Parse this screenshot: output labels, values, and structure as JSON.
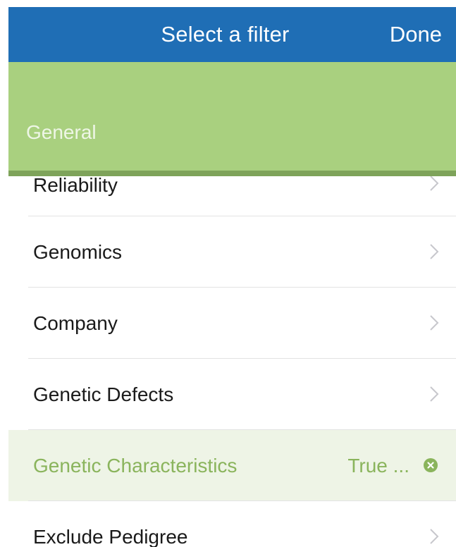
{
  "navbar": {
    "title": "Select a filter",
    "done_label": "Done",
    "color": "#1f6eb5"
  },
  "section": {
    "label": "General",
    "color": "#a9d07f"
  },
  "filters": [
    {
      "label": "Reliability",
      "value": "",
      "selected": false
    },
    {
      "label": "Genomics",
      "value": "",
      "selected": false
    },
    {
      "label": "Company",
      "value": "",
      "selected": false
    },
    {
      "label": "Genetic Defects",
      "value": "",
      "selected": false
    },
    {
      "label": "Genetic Characteristics",
      "value": "True ...",
      "selected": true
    },
    {
      "label": "Exclude Pedigree",
      "value": "",
      "selected": false
    }
  ],
  "icons": {
    "chevron": "chevron-right-icon",
    "clear": "clear-circle-icon"
  },
  "accent_color": "#8ab45c"
}
